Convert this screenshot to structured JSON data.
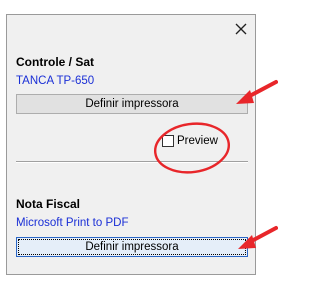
{
  "dialog": {
    "close_glyph": "✕"
  },
  "sat": {
    "title": "Controle / Sat",
    "printer": "TANCA TP-650",
    "button_label": "Definir impressora",
    "preview_label": "Preview",
    "preview_checked": false
  },
  "nfe": {
    "title": "Nota Fiscal",
    "printer": "Microsoft Print to PDF",
    "button_label": "Definir impressora"
  },
  "annotations": {
    "color": "#e8262a",
    "items": [
      "arrow-icon",
      "arrow-icon",
      "circle-highlight"
    ]
  }
}
